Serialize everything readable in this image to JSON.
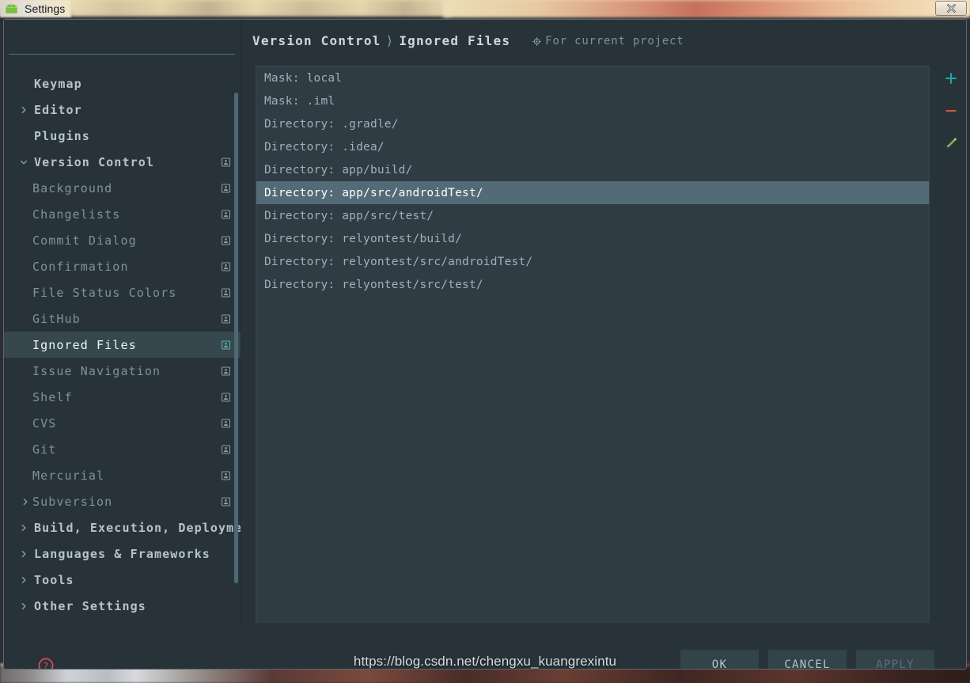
{
  "window": {
    "title": "Settings",
    "icon": "android-icon",
    "close_label": "×"
  },
  "search": {
    "value": "",
    "placeholder": ""
  },
  "sidebar": {
    "items": [
      {
        "label": "Keymap",
        "level": 0,
        "arrow": "none",
        "badge": false,
        "selected": false
      },
      {
        "label": "Editor",
        "level": 0,
        "arrow": "collapsed",
        "badge": false,
        "selected": false
      },
      {
        "label": "Plugins",
        "level": 0,
        "arrow": "none",
        "badge": false,
        "selected": false
      },
      {
        "label": "Version Control",
        "level": 0,
        "arrow": "expanded",
        "badge": true,
        "selected": false
      },
      {
        "label": "Background",
        "level": 1,
        "arrow": "none",
        "badge": true,
        "selected": false
      },
      {
        "label": "Changelists",
        "level": 1,
        "arrow": "none",
        "badge": true,
        "selected": false
      },
      {
        "label": "Commit Dialog",
        "level": 1,
        "arrow": "none",
        "badge": true,
        "selected": false
      },
      {
        "label": "Confirmation",
        "level": 1,
        "arrow": "none",
        "badge": true,
        "selected": false
      },
      {
        "label": "File Status Colors",
        "level": 1,
        "arrow": "none",
        "badge": true,
        "selected": false
      },
      {
        "label": "GitHub",
        "level": 1,
        "arrow": "none",
        "badge": true,
        "selected": false
      },
      {
        "label": "Ignored Files",
        "level": 1,
        "arrow": "none",
        "badge": true,
        "selected": true
      },
      {
        "label": "Issue Navigation",
        "level": 1,
        "arrow": "none",
        "badge": true,
        "selected": false
      },
      {
        "label": "Shelf",
        "level": 1,
        "arrow": "none",
        "badge": true,
        "selected": false
      },
      {
        "label": "CVS",
        "level": 1,
        "arrow": "none",
        "badge": true,
        "selected": false
      },
      {
        "label": "Git",
        "level": 1,
        "arrow": "none",
        "badge": true,
        "selected": false
      },
      {
        "label": "Mercurial",
        "level": 1,
        "arrow": "none",
        "badge": true,
        "selected": false
      },
      {
        "label": "Subversion",
        "level": 1,
        "arrow": "collapsed",
        "badge": true,
        "selected": false
      },
      {
        "label": "Build, Execution, Deploymen",
        "level": 0,
        "arrow": "collapsed",
        "badge": false,
        "selected": false
      },
      {
        "label": "Languages & Frameworks",
        "level": 0,
        "arrow": "collapsed",
        "badge": false,
        "selected": false
      },
      {
        "label": "Tools",
        "level": 0,
        "arrow": "collapsed",
        "badge": false,
        "selected": false
      },
      {
        "label": "Other Settings",
        "level": 0,
        "arrow": "collapsed",
        "badge": false,
        "selected": false
      }
    ]
  },
  "content": {
    "breadcrumb": {
      "root": "Version Control",
      "separator": "⟩",
      "leaf": "Ignored Files"
    },
    "scope": {
      "icon": "project-scope-icon",
      "text": "For current project"
    },
    "list": [
      {
        "text": "Mask: local",
        "selected": false
      },
      {
        "text": "Mask: .iml",
        "selected": false
      },
      {
        "text": "Directory: .gradle/",
        "selected": false
      },
      {
        "text": "Directory: .idea/",
        "selected": false
      },
      {
        "text": "Directory: app/build/",
        "selected": false
      },
      {
        "text": "Directory: app/src/androidTest/",
        "selected": true
      },
      {
        "text": "Directory: app/src/test/",
        "selected": false
      },
      {
        "text": "Directory: relyontest/build/",
        "selected": false
      },
      {
        "text": "Directory: relyontest/src/androidTest/",
        "selected": false
      },
      {
        "text": "Directory: relyontest/src/test/",
        "selected": false
      }
    ],
    "toolbar": [
      {
        "name": "add-button",
        "icon": "plus-icon",
        "color": "#21a5a5"
      },
      {
        "name": "remove-button",
        "icon": "minus-icon",
        "color": "#d4593f"
      },
      {
        "name": "edit-button",
        "icon": "pencil-icon",
        "color": "#6cb33f"
      }
    ]
  },
  "footer": {
    "help_label": "?",
    "ok_label": "OK",
    "cancel_label": "CANCEL",
    "apply_label": "APPLY",
    "apply_disabled": true
  },
  "watermark": {
    "text": "https://blog.csdn.net/chengxu_kuangrexintu"
  },
  "colors": {
    "dialog_bg": "#283339",
    "list_bg": "#2f3c44",
    "list_selection": "#536b76",
    "tree_selection": "#36474e",
    "accent_add": "#21a5a5",
    "accent_remove": "#d4593f",
    "accent_edit": "#6cb33f",
    "help_red": "#e0485f",
    "text_primary": "#b7c3ca",
    "text_secondary": "#7f929c"
  }
}
